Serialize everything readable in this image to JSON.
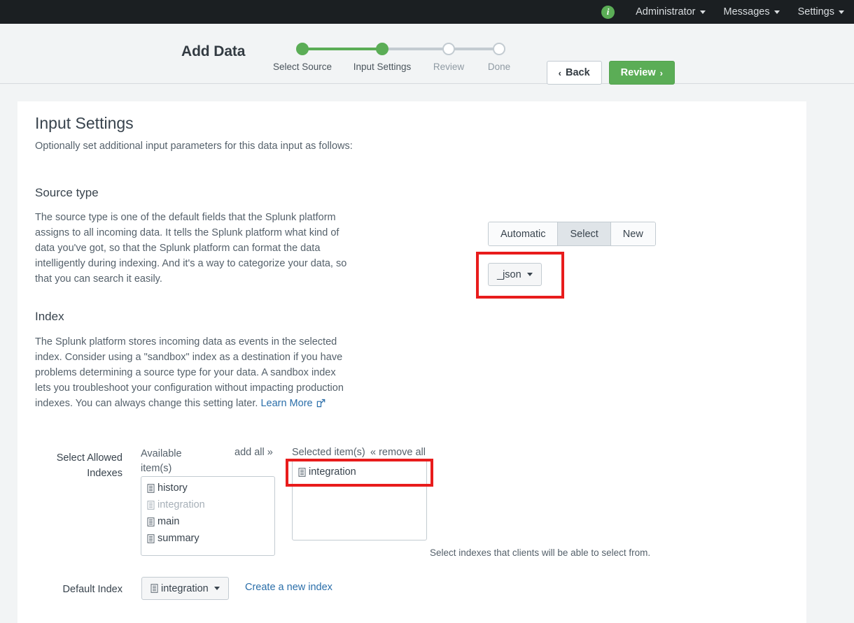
{
  "topbar": {
    "info_icon": "info-icon",
    "items": [
      {
        "label": "Administrator",
        "name": "administrator"
      },
      {
        "label": "Messages",
        "name": "messages"
      },
      {
        "label": "Settings",
        "name": "settings"
      }
    ]
  },
  "wizard": {
    "title": "Add Data",
    "steps": [
      {
        "label": "Select Source",
        "state": "done"
      },
      {
        "label": "Input Settings",
        "state": "done"
      },
      {
        "label": "Review",
        "state": "upcoming"
      },
      {
        "label": "Done",
        "state": "upcoming"
      }
    ],
    "back_label": "Back",
    "back_chevron": "‹",
    "review_label": "Review",
    "review_chevron": "›"
  },
  "page": {
    "title": "Input Settings",
    "subtitle": "Optionally set additional input parameters for this data input as follows:"
  },
  "source_type": {
    "title": "Source type",
    "body": "The source type is one of the default fields that the Splunk platform assigns to all incoming data. It tells the Splunk platform what kind of data you've got, so that the Splunk platform can format the data intelligently during indexing. And it's a way to categorize your data, so that you can search it easily.",
    "segments": [
      {
        "label": "Automatic",
        "active": false
      },
      {
        "label": "Select",
        "active": true
      },
      {
        "label": "New",
        "active": false
      }
    ],
    "selected_value": "_json"
  },
  "index": {
    "title": "Index",
    "body_before_link": "The Splunk platform stores incoming data as events in the selected index. Consider using a \"sandbox\" index as a destination if you have problems determining a source type for your data. A sandbox index lets you troubleshoot your configuration without impacting production indexes. You can always change this setting later. ",
    "learn_more_label": "Learn More",
    "allowed_label": "Select Allowed Indexes",
    "available_header": "Available item(s)",
    "add_all_label": "add all »",
    "selected_header": "Selected item(s)",
    "remove_all_label": "« remove all",
    "available_items": [
      {
        "label": "history",
        "disabled": false
      },
      {
        "label": "integration",
        "disabled": true
      },
      {
        "label": "main",
        "disabled": false
      },
      {
        "label": "summary",
        "disabled": false
      }
    ],
    "selected_items": [
      {
        "label": "integration"
      }
    ],
    "helper_text": "Select indexes that clients will be able to select from.",
    "default_index_label": "Default Index",
    "default_index_value": "integration",
    "create_index_label": "Create a new index"
  },
  "colors": {
    "accent_green": "#5bad56",
    "link_blue": "#2a6ea9",
    "annotation_red": "#e81c1c",
    "topbar_dark": "#1b1f22"
  }
}
